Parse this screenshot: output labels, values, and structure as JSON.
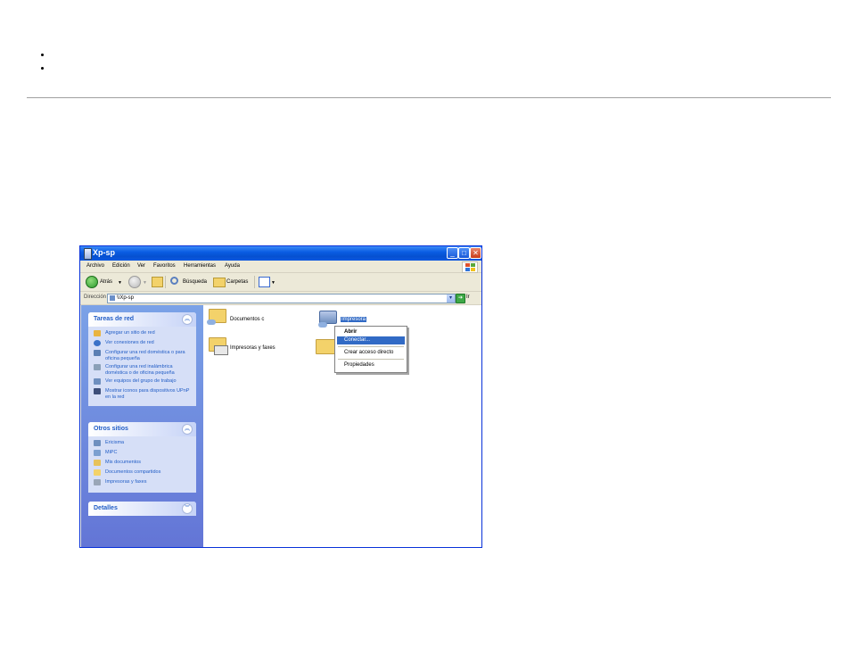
{
  "window": {
    "title": "Xp-sp",
    "menu": [
      "Archivo",
      "Edición",
      "Ver",
      "Favoritos",
      "Herramientas",
      "Ayuda"
    ],
    "toolbar": {
      "back": "Atrás",
      "search": "Búsqueda",
      "folders": "Carpetas"
    },
    "address": {
      "label": "Dirección",
      "value": "\\\\Xp-sp",
      "go": "Ir"
    }
  },
  "left_pane": {
    "network_tasks": {
      "title": "Tareas de red",
      "links": [
        "Agregar un sitio de red",
        "Ver conexiones de red",
        "Configurar una red doméstica o para oficina pequeña",
        "Configurar una red inalámbrica doméstica o de oficina pequeña",
        "Ver equipos del grupo de trabajo",
        "Mostrar iconos para dispositivos UPnP en la red"
      ]
    },
    "other_places": {
      "title": "Otros sitios",
      "links": [
        "Ericisma",
        "MiPC",
        "Mis documentos",
        "Documentos compartidos",
        "Impresoras y faxes"
      ]
    },
    "details": {
      "title": "Detalles"
    }
  },
  "items": [
    {
      "label": "Documentos c"
    },
    {
      "label": "Impresora"
    },
    {
      "label": "Impresoras y faxes"
    }
  ],
  "context_menu": {
    "items": [
      "Abrir",
      "Conectar...",
      "Crear acceso directo",
      "Propiedades"
    ],
    "highlighted": "Conectar..."
  },
  "colors": {
    "titlebar": "#0a5de3",
    "task_pane": "#6375d6",
    "link": "#215dc6",
    "selection": "#316ac5"
  }
}
